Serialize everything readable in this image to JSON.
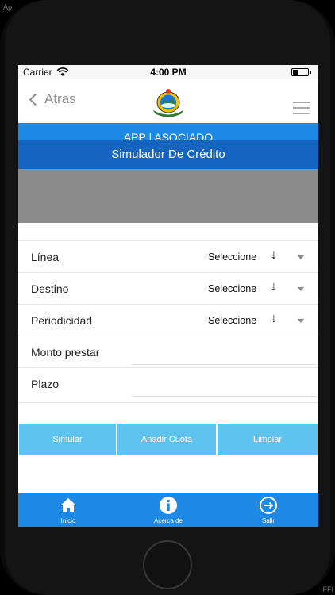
{
  "corner": {
    "top_left": "Ap",
    "bottom_right": "FFI"
  },
  "status_bar": {
    "carrier": "Carrier",
    "time": "4:00 PM"
  },
  "nav": {
    "back_label": "Atras"
  },
  "headers": {
    "app": "APP | ASOCIADO",
    "simulator": "Simulador De Crédito"
  },
  "form": {
    "rows": [
      {
        "label": "Línea",
        "select": "Seleccione",
        "arrow": "↓"
      },
      {
        "label": "Destino",
        "select": "Seleccione",
        "arrow": "↓"
      },
      {
        "label": "Periodicidad",
        "select": "Seleccione",
        "arrow": "↓"
      },
      {
        "label": "Monto prestar",
        "value": ""
      },
      {
        "label": "Plazo",
        "value": ""
      }
    ]
  },
  "actions": {
    "simulate": "Simular",
    "add_fee": "Añadir Cuota",
    "clear": "Limpiar"
  },
  "tabs": [
    {
      "label": "Inicio",
      "icon": "home-icon"
    },
    {
      "label": "Acerca de",
      "icon": "info-icon"
    },
    {
      "label": "Salir",
      "icon": "logout-icon"
    }
  ],
  "colors": {
    "primary": "#1e88e5",
    "primary_dark": "#1565c0",
    "button": "#5ec3ef",
    "banner": "#8c8c8c"
  }
}
